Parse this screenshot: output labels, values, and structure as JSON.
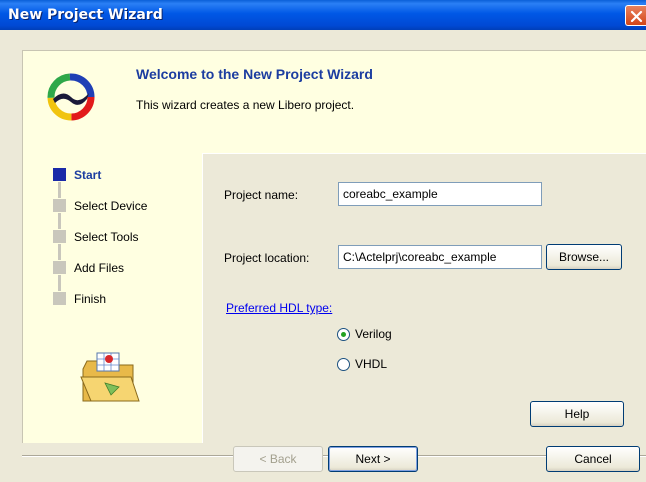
{
  "window": {
    "title": "New Project Wizard"
  },
  "header": {
    "title": "Welcome to the New Project Wizard",
    "subtitle": "This wizard creates a new Libero project."
  },
  "steps": [
    {
      "label": "Start",
      "active": true
    },
    {
      "label": "Select Device",
      "active": false
    },
    {
      "label": "Select Tools",
      "active": false
    },
    {
      "label": "Add Files",
      "active": false
    },
    {
      "label": "Finish",
      "active": false
    }
  ],
  "form": {
    "project_name_label": "Project name:",
    "project_name_value": "coreabc_example",
    "project_location_label": "Project location:",
    "project_location_value": "C:\\Actelprj\\coreabc_example",
    "browse_label": "Browse...",
    "hdl_label": "Preferred HDL type:",
    "hdl_options": [
      {
        "label": "Verilog",
        "checked": true
      },
      {
        "label": "VHDL",
        "checked": false
      }
    ],
    "help_label": "Help"
  },
  "footer": {
    "back_label": "< Back",
    "next_label": "Next >",
    "cancel_label": "Cancel"
  },
  "colors": {
    "titlebar": "#0058e6",
    "accent_blue": "#1c3da0",
    "frame_bg": "#ffffe1",
    "dialog_bg": "#ece9d8"
  }
}
